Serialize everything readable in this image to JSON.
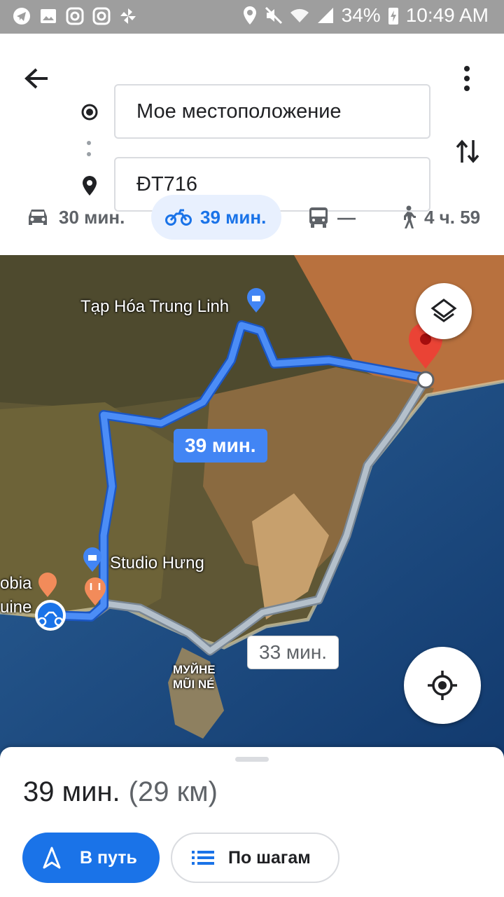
{
  "status_bar": {
    "battery": "34%",
    "time": "10:49 AM",
    "icons_left": [
      "telegram-icon",
      "image-icon",
      "instagram-icon",
      "instagram-icon",
      "pinwheel-icon"
    ],
    "icons_right": [
      "location-icon",
      "mute-icon",
      "wifi-icon",
      "signal-icon",
      "battery-charging-icon"
    ]
  },
  "directions": {
    "origin_value": "Мое местоположение",
    "destination_value": "ĐT716"
  },
  "modes": [
    {
      "icon": "car-icon",
      "label": "30 мин.",
      "active": false
    },
    {
      "icon": "motorcycle-icon",
      "label": "39 мин.",
      "active": true
    },
    {
      "icon": "bus-icon",
      "label": "—",
      "active": false
    },
    {
      "icon": "walk-icon",
      "label": "4 ч. 59",
      "active": false
    }
  ],
  "map": {
    "place_1": "Tạp Hóa Trung Linh",
    "place_2": "Studio Hưng",
    "place_3_line1": "obia",
    "place_3_line2": "uine",
    "place_4_line1": "МУЙНЕ",
    "place_4_line2": "MŨI NÉ",
    "route_primary": "39 мин.",
    "route_alt": "33 мин.",
    "colors": {
      "route": "#4285f4",
      "alt_route": "#9aa8b5",
      "destination_pin": "#ea4335"
    }
  },
  "bottom_sheet": {
    "duration": "39 мин.",
    "distance": "(29 км)",
    "start_label": "В путь",
    "steps_label": "По шагам"
  }
}
